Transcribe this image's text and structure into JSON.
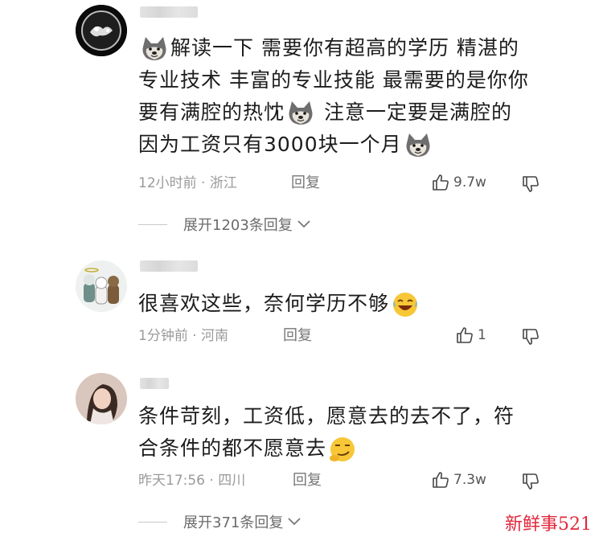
{
  "comments": [
    {
      "text_parts": [
        "解读一下  需要你有超高的学历 精湛的专业技术 丰富的专业技能 最需要的是你你要有满腔的热忱",
        "注意一定要是满腔的因为工资只有3000块一个月"
      ],
      "line1": "解读一下  需要你有超高的学历 精湛的",
      "line2": "专业技术 丰富的专业技能 最需要的是你你",
      "line3a": "要有满腔的热忱",
      "line3b": " 注意一定要是满腔的",
      "line4": "因为工资只有3000块一个月",
      "time": "12小时前 · 浙江",
      "reply_label": "回复",
      "likes": "9.7w",
      "expand_label": "展开1203条回复"
    },
    {
      "line1": "很喜欢这些，奈何学历不够",
      "time": "1分钟前 · 河南",
      "reply_label": "回复",
      "likes": "1"
    },
    {
      "line1": "条件苛刻，工资低，愿意去的去不了，符",
      "line2": "合条件的都不愿意去",
      "time": "昨天17:56 · 四川",
      "reply_label": "回复",
      "likes": "7.3w",
      "expand_label": "展开371条回复"
    }
  ],
  "watermark": "新鲜事521",
  "icons": {
    "emoji_doge": "doge-emoji",
    "emoji_laugh_cry": "laugh-cry-emoji",
    "emoji_smirk": "smirk-emoji",
    "like": "thumbs-up-icon",
    "dislike": "thumbs-down-icon",
    "chevron": "chevron-down-icon"
  }
}
